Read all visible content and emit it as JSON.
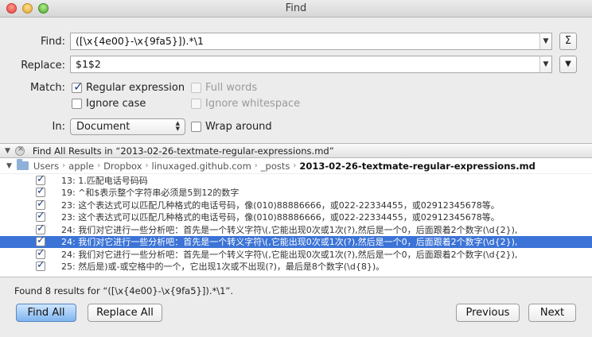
{
  "window": {
    "title": "Find"
  },
  "find": {
    "label": "Find:",
    "value": "([\\x{4e00}-\\x{9fa5}]).*\\1"
  },
  "replace": {
    "label": "Replace:",
    "value": "$1$2"
  },
  "sigma_label": "Σ",
  "replace_menu_label": "▼",
  "match": {
    "label": "Match:",
    "regular_expression": {
      "label": "Regular expression",
      "checked": true
    },
    "full_words": {
      "label": "Full words",
      "checked": false,
      "enabled": false
    },
    "ignore_case": {
      "label": "Ignore case",
      "checked": false
    },
    "ignore_whitespace": {
      "label": "Ignore whitespace",
      "checked": false,
      "enabled": false
    }
  },
  "in": {
    "label": "In:",
    "selected": "Document"
  },
  "wrap_around": {
    "label": "Wrap around",
    "checked": false
  },
  "results": {
    "header": "Find All Results in “2013-02-26-textmate-regular-expressions.md”",
    "path": [
      "Users",
      "apple",
      "Dropbox",
      "linuxaged.github.com",
      "_posts",
      "2013-02-26-textmate-regular-expressions.md"
    ],
    "rows": [
      {
        "text": "13: 1.匹配电话号码码",
        "checked": true,
        "selected": false
      },
      {
        "text": "19: ^和$表示整个字符串必须是5到12的数字",
        "checked": true,
        "selected": false
      },
      {
        "text": "23: 这个表达式可以匹配几种格式的电话号码，像(010)88886666，或022-22334455，或02912345678等。",
        "checked": true,
        "selected": false
      },
      {
        "text": "23: 这个表达式可以匹配几种格式的电话号码，像(010)88886666，或022-22334455，或02912345678等。",
        "checked": true,
        "selected": false
      },
      {
        "text": "24: 我们对它进行一些分析吧：首先是一个转义字符\\(,它能出现0次或1次(?),然后是一个0，后面跟着2个数字(\\d{2}),",
        "checked": true,
        "selected": false
      },
      {
        "text": "24: 我们对它进行一些分析吧：首先是一个转义字符\\(,它能出现0次或1次(?),然后是一个0，后面跟着2个数字(\\d{2}),",
        "checked": true,
        "selected": true
      },
      {
        "text": "24: 我们对它进行一些分析吧：首先是一个转义字符\\(,它能出现0次或1次(?),然后是一个0，后面跟着2个数字(\\d{2}),",
        "checked": true,
        "selected": false
      },
      {
        "text": "25: 然后是)或-或空格中的一个，它出现1次或不出现(?)，最后是8个数字(\\d{8})。",
        "checked": true,
        "selected": false
      }
    ]
  },
  "status": "Found 8 results for “([\\x{4e00}-\\x{9fa5}]).*\\1”.",
  "buttons": {
    "find_all": "Find All",
    "replace_all": "Replace All",
    "previous": "Previous",
    "next": "Next"
  },
  "icons": {
    "close": "close-dot-icon",
    "minimize": "minimize-dot-icon",
    "maximize": "maximize-dot-icon",
    "stop": "stop-icon",
    "folder": "folder-icon",
    "checkbox": "checkmark-icon",
    "disclosure": "disclosure-triangle-icon"
  }
}
